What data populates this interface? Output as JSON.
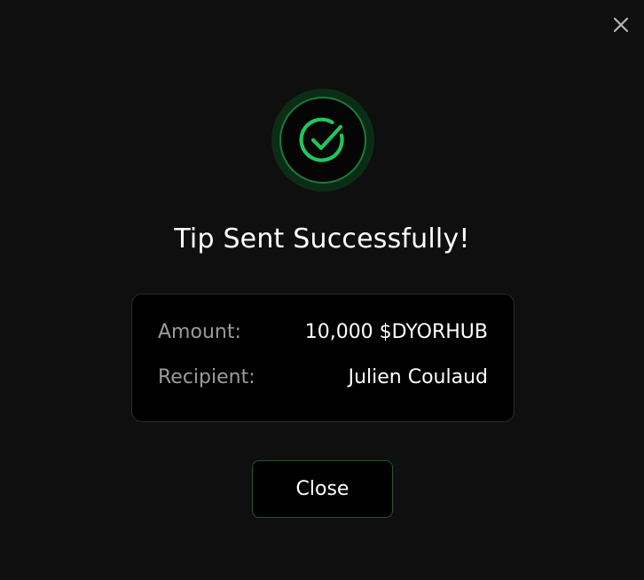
{
  "dialog": {
    "title": "Tip Sent Successfully!",
    "close_icon": "close-icon",
    "success_icon": "check-circle-icon"
  },
  "details": {
    "amount_label": "Amount:",
    "amount_value": "10,000 $DYORHUB",
    "recipient_label": "Recipient:",
    "recipient_value": "Julien Coulaud"
  },
  "actions": {
    "close_label": "Close"
  },
  "colors": {
    "background": "#0f0f0f",
    "accent_green": "#22c55e",
    "badge_ring": "#0b2d15",
    "card_border": "#2b2b2b",
    "button_border": "#1c5a2c",
    "label_gray": "#9b9b9b",
    "text_white": "#ffffff"
  }
}
